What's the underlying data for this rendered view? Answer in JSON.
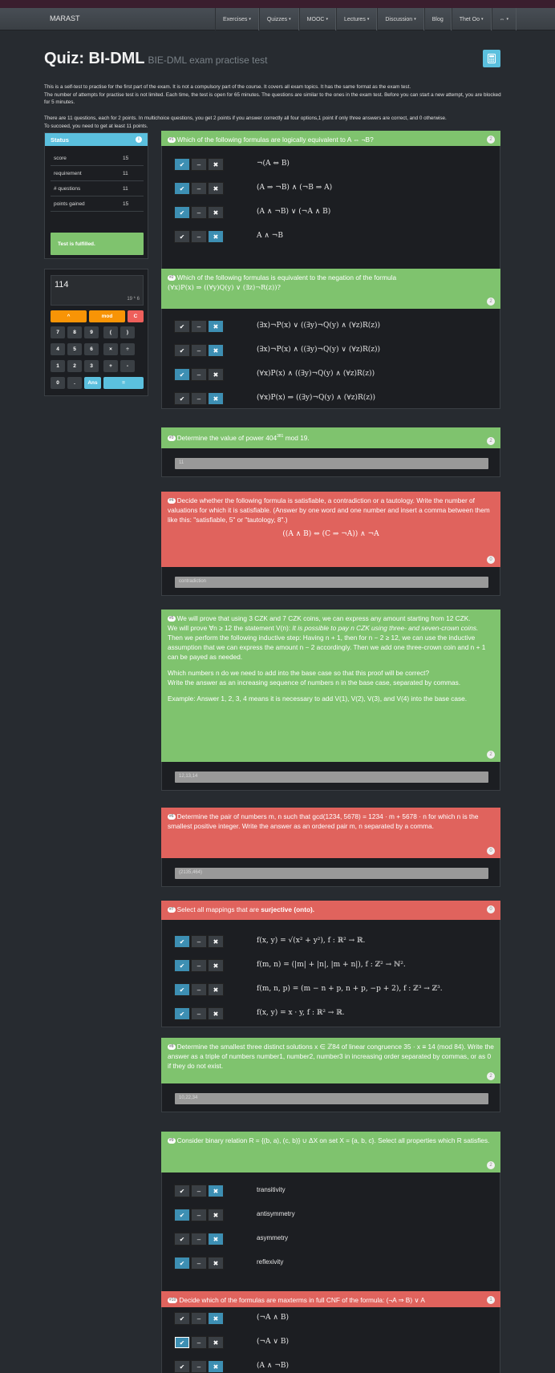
{
  "nav": {
    "brand": "MARAST",
    "items": [
      {
        "label": "Exercises",
        "caret": true
      },
      {
        "label": "Quizzes",
        "caret": true
      },
      {
        "label": "MOOC",
        "caret": true
      },
      {
        "label": "Lectures",
        "caret": true
      },
      {
        "label": "Discussion",
        "caret": true
      },
      {
        "label": "Blog",
        "caret": false
      },
      {
        "label": "Thet Oo",
        "caret": true
      },
      {
        "label": "⇔",
        "caret": true
      }
    ]
  },
  "title": {
    "main": "Quiz: BI-DML",
    "sub": "BIE-DML exam practise test"
  },
  "intro": {
    "p1": "This is a self-test to practise for the first part of the exam. It is not a compulsory part of the course. It covers all exam topics. It has the same format as the exam test.",
    "p2": "The number of attempts for practise test is not limited. Each time, the test is open for 65 minutes. The questions are similar to the ones in the exam test. Before you can start a new attempt, you are blocked for 5 minutes.",
    "p3": "There are 11 questions, each for 2 points. In multichoice questions, you get 2 points if you answer correctly all four options,1 point if only three answers are correct, and 0 otherwise.",
    "p4": "To succeed, you need to get at least 11 points."
  },
  "status": {
    "header": "Status",
    "rows": [
      {
        "k": "score",
        "v": "15"
      },
      {
        "k": "requirement",
        "v": "11"
      },
      {
        "k": "# questions",
        "v": "11"
      },
      {
        "k": "points gained",
        "v": "15"
      }
    ],
    "fulfilled": "Test is fulfilled."
  },
  "calc": {
    "value": "114",
    "expr": "19 * 6",
    "keys": [
      [
        "^",
        "mod",
        "C"
      ],
      [
        "7",
        "8",
        "9",
        "(",
        ")"
      ],
      [
        "4",
        "5",
        "6",
        "×",
        "÷"
      ],
      [
        "1",
        "2",
        "3",
        "+",
        "-"
      ],
      [
        "0",
        ".",
        "Ans",
        "="
      ]
    ]
  },
  "questions": [
    {
      "n": "#1",
      "pts": "2",
      "text": "Which of the following formulas are logically equivalent to A ⇔ ¬B?",
      "status": "ok",
      "options": [
        {
          "t": "¬(A ⇔ B)",
          "sel": "check"
        },
        {
          "t": "(A ⇒ ¬B) ∧ (¬B ⇒ A)",
          "sel": "check"
        },
        {
          "t": "(A ∧ ¬B) ∨ (¬A ∧ B)",
          "sel": "check"
        },
        {
          "t": "A ∧ ¬B",
          "sel": "cross"
        }
      ]
    },
    {
      "n": "#2",
      "pts": "2",
      "text": "Which of the following formulas is equivalent to the negation of the formula",
      "formula": "(∀x)P(x) ⇒ ((∀y)Q(y) ∨ (∃z)¬R(z))?",
      "status": "ok",
      "options": [
        {
          "t": "(∃x)¬P(x) ∨ ((∃y)¬Q(y) ∧ (∀z)R(z))",
          "sel": "cross"
        },
        {
          "t": "(∃x)¬P(x) ∧ ((∃y)¬Q(y) ∨ (∀z)R(z))",
          "sel": "cross"
        },
        {
          "t": "(∀x)P(x) ∧ ((∃y)¬Q(y) ∧ (∀z)R(z))",
          "sel": "check"
        },
        {
          "t": "(∀x)P(x) ⇒ ((∃y)¬Q(y) ∧ (∀z)R(z))",
          "sel": "cross"
        }
      ]
    },
    {
      "n": "#3",
      "pts": "2",
      "text": "Determine the value of power 404",
      "sup": "381",
      "text2": " mod 19.",
      "status": "ok",
      "answer": "11"
    },
    {
      "n": "#4",
      "pts": "0",
      "text": "Decide whether the following formula is satisfiable, a contradiction or a tautology. Write the number of valuations for which it is satisfiable. (Answer by one word and one number and insert a comma between them like this: \"satisfiable, 5\" or \"tautology, 8\".)",
      "formula": "((A ∧ B) ⇔ (C ⇒ ¬A)) ∧ ¬A",
      "status": "bad",
      "answer": "contradiction"
    },
    {
      "n": "#5",
      "pts": "2",
      "l1": "We will prove that using 3 CZK and 7 CZK coins, we can express any amount starting from 12 CZK.",
      "l2a": "We will prove ∀n ≥ 12 the statement V(n): ",
      "l2b": "It is possible to pay n CZK using three- and seven-crown coins.",
      "l3": "Then we perform the following inductive step: Having n + 1, then for n − 2 ≥ 12, we can use the inductive assumption that we can express the amount n − 2 accordingly. Then we add one three-crown coin and n + 1 can be payed as needed.",
      "l4": "Which numbers n do we need to add into the base case so that this proof will be correct?",
      "l5": "Write the answer as an increasing sequence of numbers n in the base case, separated by commas.",
      "l6": "Example: Answer 1, 2, 3, 4 means it is necessary to add V(1), V(2), V(3), and V(4) into the base case.",
      "status": "ok",
      "answer": "12,13,14"
    },
    {
      "n": "#6",
      "pts": "0",
      "text": "Determine the pair of numbers m, n such that gcd(1234, 5678) = 1234 · m + 5678 · n for which n is the smallest positive integer. Write the answer as an ordered pair m, n separated by a comma.",
      "status": "bad",
      "answer": "(2135,464)"
    },
    {
      "n": "#7",
      "pts": "0",
      "text": "Select all mappings that are ",
      "bold": "surjective (onto).",
      "status": "bad",
      "options": [
        {
          "t": "f(x, y) = √(x² + y²), f : ℝ² → ℝ.",
          "sel": "check"
        },
        {
          "t": "f(m, n) = (|m| + |n|, |m + n|), f : ℤ² → ℕ².",
          "sel": "check"
        },
        {
          "t": "f(m, n, p) = (m − n + p, n + p, −p + 2), f : ℤ³ → ℤ³.",
          "sel": "check"
        },
        {
          "t": "f(x, y) = x · y, f : ℝ² → ℝ.",
          "sel": "check"
        }
      ]
    },
    {
      "n": "#8",
      "pts": "2",
      "text": "Determine the smallest three distinct solutions x ∈ ℤ84 of linear congruence 35 · x ≡ 14 (mod 84). Write the answer as a triple of numbers number1, number2, number3 in increasing order separated by commas, or as 0 if they do not exist.",
      "status": "ok",
      "answer": "10,22,34"
    },
    {
      "n": "#9",
      "pts": "2",
      "text": "Consider binary relation R = {(b, a), (c, b)} ∪ ΔX on set X = {a, b, c}. Select all properties which R satisfies.",
      "status": "ok",
      "options": [
        {
          "t": "transitivity",
          "sel": "cross"
        },
        {
          "t": "antisymmetry",
          "sel": "check"
        },
        {
          "t": "asymmetry",
          "sel": "cross"
        },
        {
          "t": "reflexivity",
          "sel": "check"
        }
      ]
    },
    {
      "n": "#10",
      "pts": "1",
      "text": "Decide which of the formulas are maxterms in full CNF of the formula: (¬A ⇒ B) ∨ A",
      "status": "bad",
      "options": [
        {
          "t": "(¬A ∧ B)",
          "sel": "cross"
        },
        {
          "t": "(¬A ∨ B)",
          "sel": "check"
        },
        {
          "t": "(A ∧ ¬B)",
          "sel": "cross"
        }
      ]
    }
  ]
}
